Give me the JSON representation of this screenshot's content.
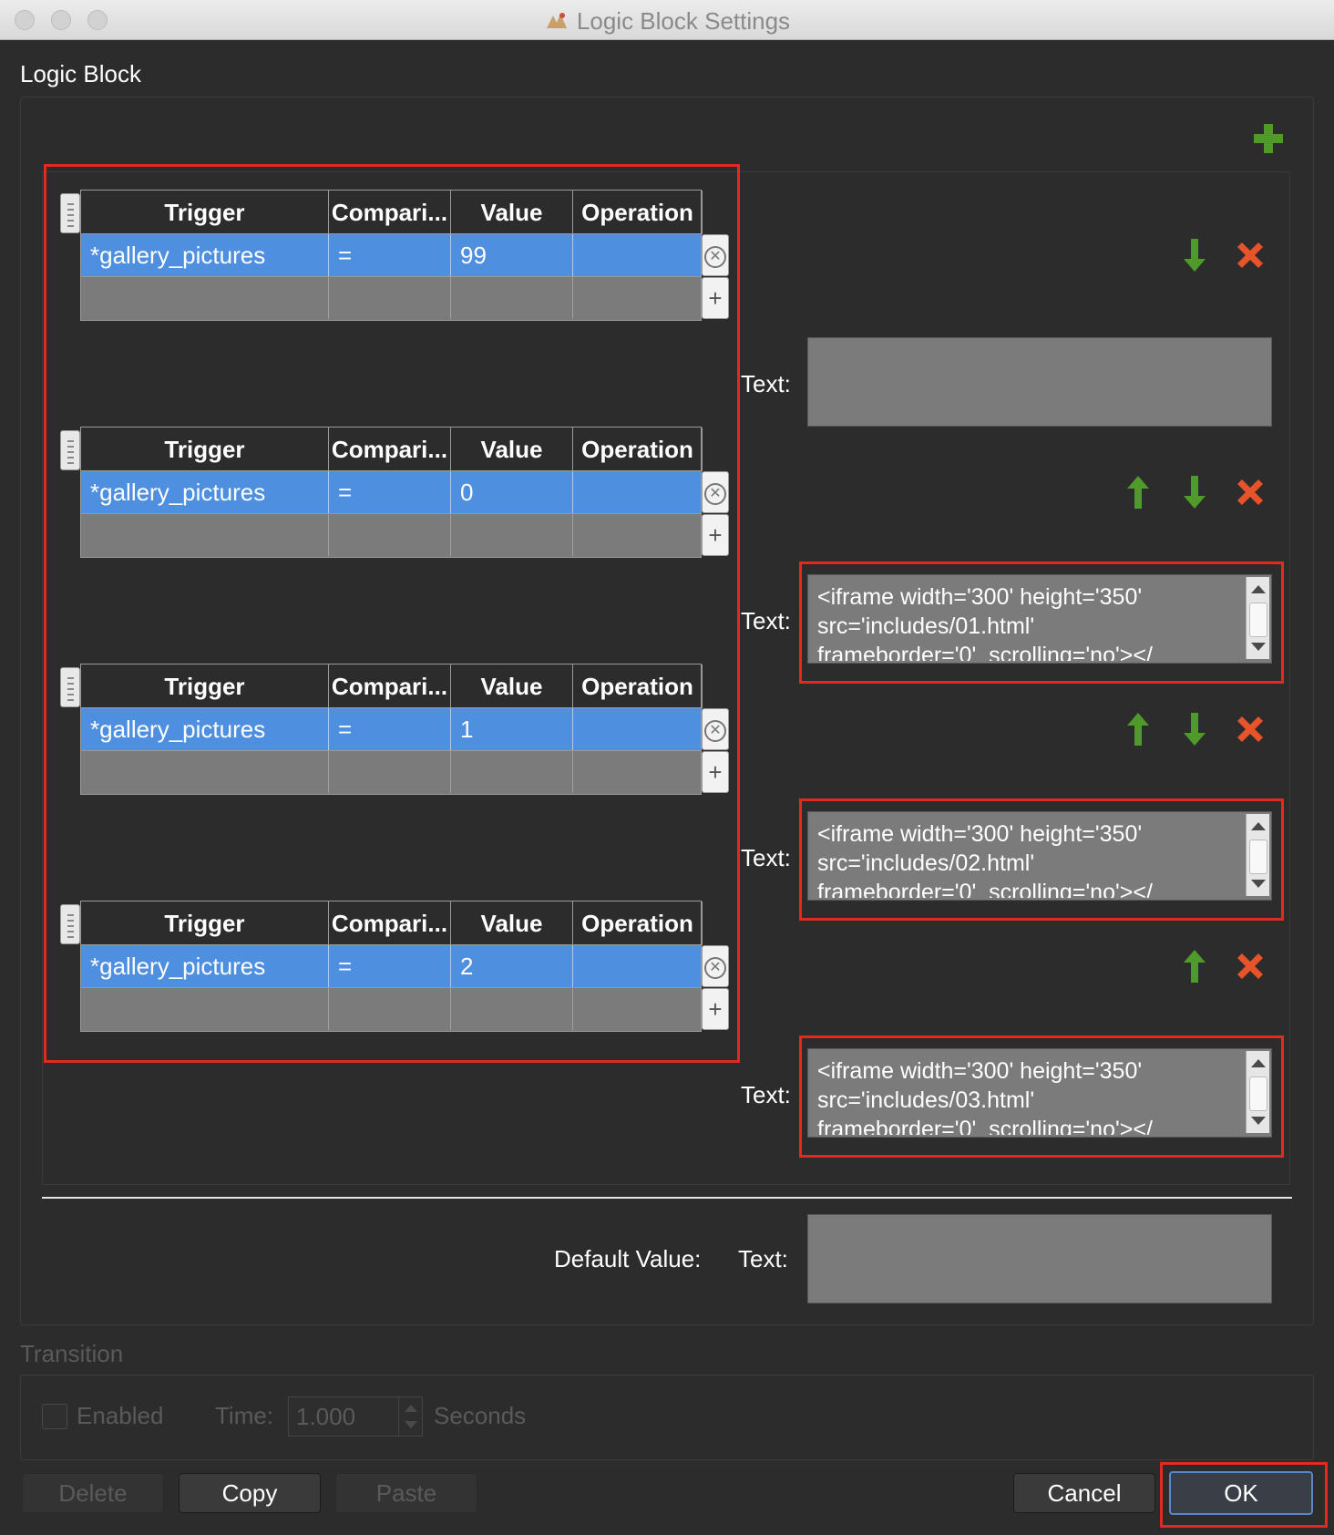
{
  "window": {
    "title": "Logic Block Settings"
  },
  "logic_block": {
    "section_title": "Logic Block",
    "add_icon": "plus-icon",
    "table_headers": {
      "trigger": "Trigger",
      "comparison": "Compari...",
      "value": "Value",
      "operation": "Operation"
    },
    "conditions": [
      {
        "trigger": "*gallery_pictures",
        "comparison": "=",
        "value": "99",
        "operation": "",
        "text_label": "Text:",
        "text": ""
      },
      {
        "trigger": "*gallery_pictures",
        "comparison": "=",
        "value": "0",
        "operation": "",
        "text_label": "Text:",
        "text": "<iframe width='300' height='350'\nsrc='includes/01.html'\nframeborder='0'  scrolling='no'></"
      },
      {
        "trigger": "*gallery_pictures",
        "comparison": "=",
        "value": "1",
        "operation": "",
        "text_label": "Text:",
        "text": "<iframe width='300' height='350'\nsrc='includes/02.html'\nframeborder='0'  scrolling='no'></"
      },
      {
        "trigger": "*gallery_pictures",
        "comparison": "=",
        "value": "2",
        "operation": "",
        "text_label": "Text:",
        "text": "<iframe width='300' height='350'\nsrc='includes/03.html'\nframeborder='0'  scrolling='no'></"
      }
    ],
    "default_value_label": "Default Value:",
    "default_text_label": "Text:",
    "default_text": ""
  },
  "transition": {
    "section_title": "Transition",
    "enabled_label": "Enabled",
    "enabled": false,
    "time_label": "Time:",
    "time_value": "1.000",
    "seconds_label": "Seconds"
  },
  "buttons": {
    "delete": "Delete",
    "copy": "Copy",
    "paste": "Paste",
    "cancel": "Cancel",
    "ok": "OK"
  },
  "colors": {
    "selection": "#4f8fe0",
    "highlight": "#e02a22",
    "arrow_green": "#4f9a2a",
    "delete_orange": "#e8542a"
  }
}
